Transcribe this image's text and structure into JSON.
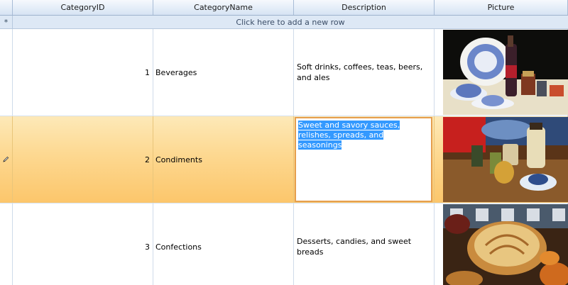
{
  "columns": {
    "id": "CategoryID",
    "name": "CategoryName",
    "description": "Description",
    "picture": "Picture"
  },
  "new_row": {
    "indicator": "*",
    "prompt": "Click here to add a new row"
  },
  "rows": [
    {
      "id": "1",
      "name": "Beverages",
      "description": "Soft drinks, coffees, teas, beers, and ales",
      "picture": "beverages-image"
    },
    {
      "id": "2",
      "name": "Condiments",
      "description": "Sweet and savory sauces, relishes, spreads, and seasonings",
      "picture": "condiments-image",
      "selected": true,
      "editing": true
    },
    {
      "id": "3",
      "name": "Confections",
      "description": "Desserts, candies, and sweet breads",
      "picture": "confections-image"
    }
  ],
  "icons": {
    "new_row": "asterisk-icon",
    "edit_row": "pencil-icon"
  },
  "colors": {
    "selected_row": "#fdd890",
    "editor_border": "#e59f4e",
    "text_selection": "#3399ff",
    "header": "#dde8f5"
  }
}
